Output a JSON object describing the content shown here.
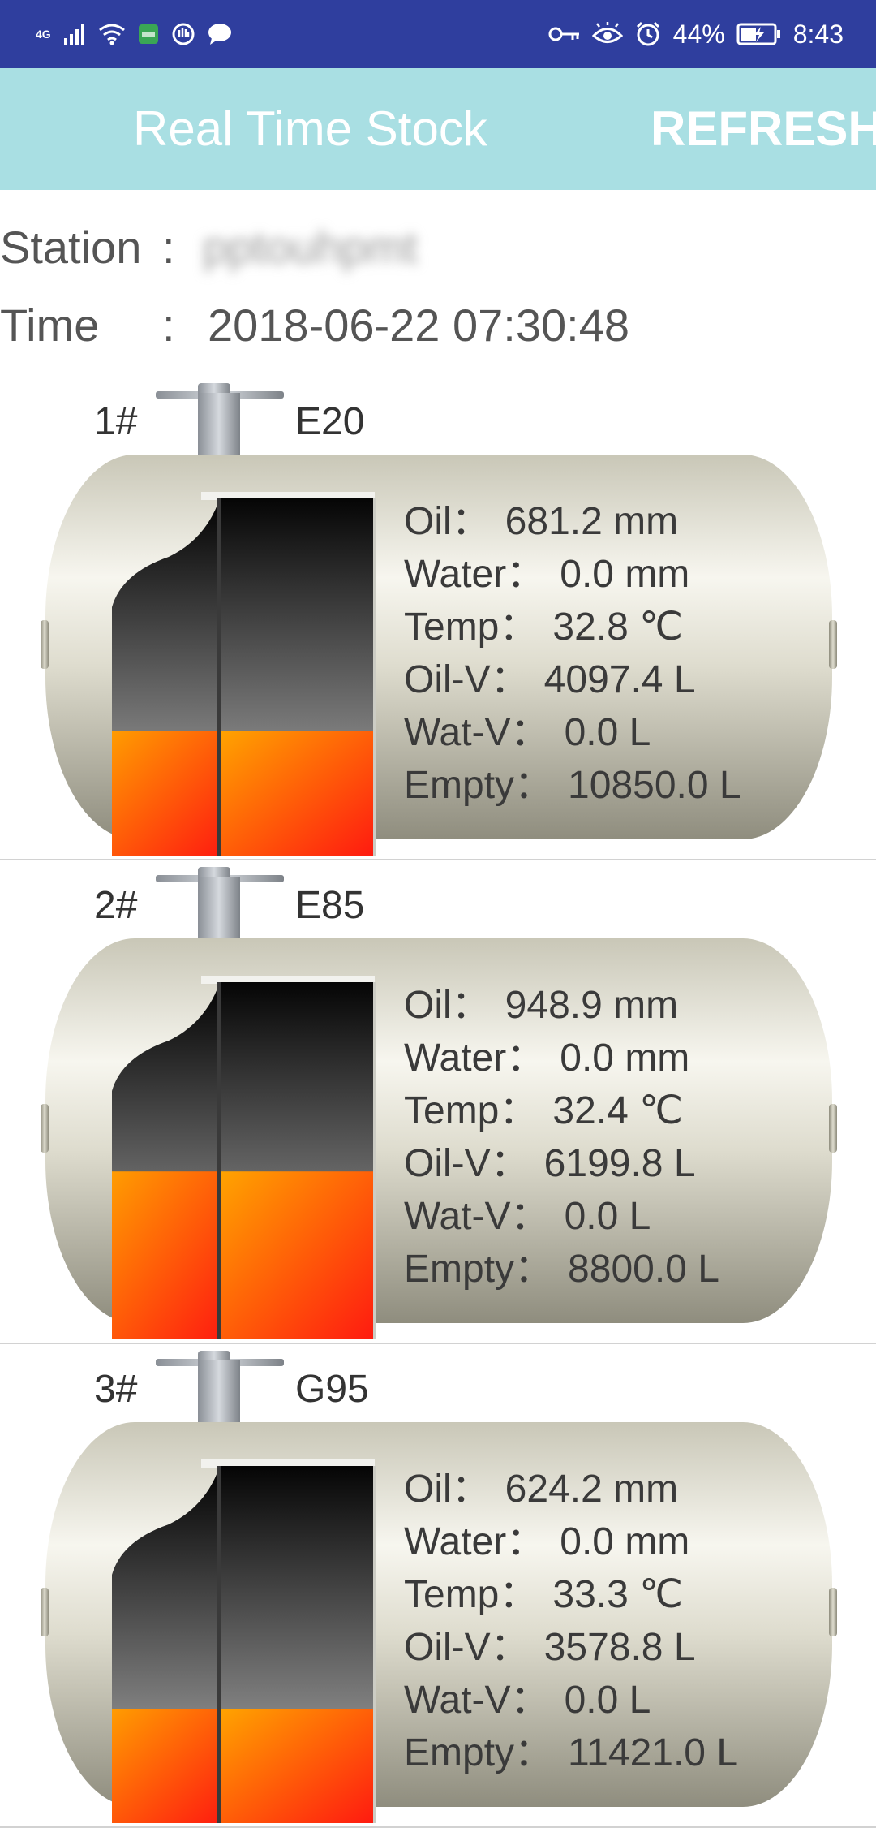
{
  "status_bar": {
    "network": "4G",
    "battery": "44%",
    "time": "8:43",
    "icons": [
      "signal-icon",
      "wifi-icon",
      "app-badge-icon",
      "hand-icon",
      "chat-icon",
      "key-icon",
      "eye-icon",
      "alarm-icon",
      "battery-icon"
    ]
  },
  "app_bar": {
    "title": "Real Time Stock",
    "refresh_label": "REFRESH"
  },
  "station": {
    "label": "Station",
    "colon": ":",
    "value": "pptouhpmt"
  },
  "time": {
    "label": "Time",
    "colon": ":",
    "value": "2018-06-22 07:30:48"
  },
  "tanks": [
    {
      "number": "1#",
      "product": "E20",
      "readings": [
        {
          "label": "Oil：",
          "value": "681.2 mm"
        },
        {
          "label": "Water：",
          "value": "0.0 mm"
        },
        {
          "label": "Temp：",
          "value": "32.8 ℃"
        },
        {
          "label": "Oil-V：",
          "value": "4097.4 L"
        },
        {
          "label": "Wat-V：",
          "value": "0.0 L"
        },
        {
          "label": "Empty：",
          "value": "10850.0 L"
        }
      ],
      "fill_fraction": 0.35
    },
    {
      "number": "2#",
      "product": "E85",
      "readings": [
        {
          "label": "Oil：",
          "value": "948.9 mm"
        },
        {
          "label": "Water：",
          "value": "0.0 mm"
        },
        {
          "label": "Temp：",
          "value": "32.4 ℃"
        },
        {
          "label": "Oil-V：",
          "value": "6199.8 L"
        },
        {
          "label": "Wat-V：",
          "value": "0.0 L"
        },
        {
          "label": "Empty：",
          "value": "8800.0 L"
        }
      ],
      "fill_fraction": 0.47
    },
    {
      "number": "3#",
      "product": "G95",
      "readings": [
        {
          "label": "Oil：",
          "value": "624.2 mm"
        },
        {
          "label": "Water：",
          "value": "0.0 mm"
        },
        {
          "label": "Temp：",
          "value": "33.3 ℃"
        },
        {
          "label": "Oil-V：",
          "value": "3578.8 L"
        },
        {
          "label": "Wat-V：",
          "value": "0.0 L"
        },
        {
          "label": "Empty：",
          "value": "11421.0 L"
        }
      ],
      "fill_fraction": 0.32
    }
  ],
  "colors": {
    "status_bar": "#2f3e9e",
    "app_bar": "#a9dfe3",
    "tank_body": "#d8d6c8",
    "fuel_light": "#ffa400",
    "fuel_dark": "#ff1a10"
  }
}
